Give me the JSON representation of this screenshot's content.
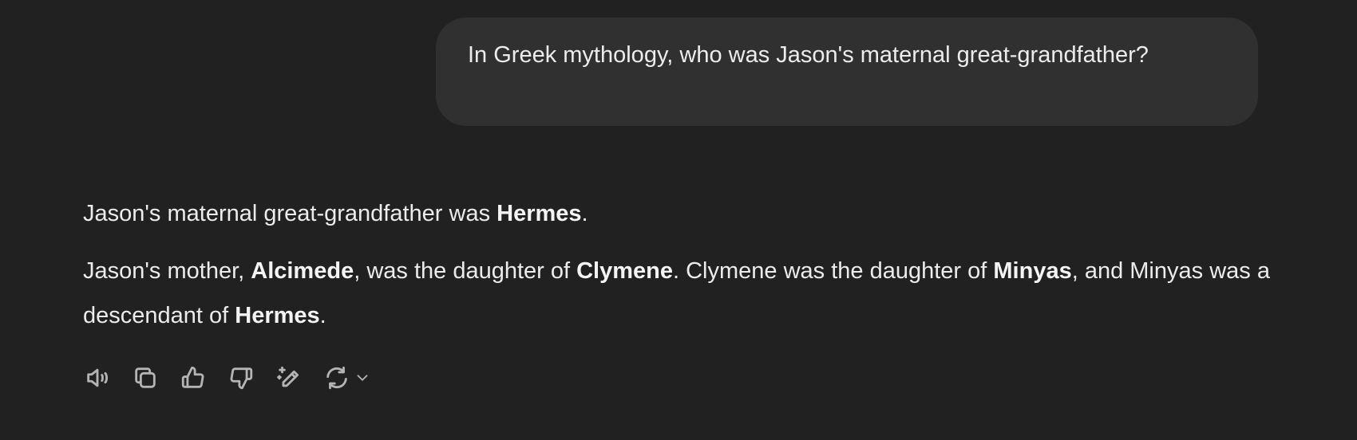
{
  "user_message": {
    "text": "In Greek mythology, who was Jason's maternal great-grandfather?"
  },
  "assistant_message": {
    "p1": {
      "t1": "Jason's maternal great-grandfather was ",
      "b1": "Hermes",
      "t2": "."
    },
    "p2": {
      "t1": "Jason's mother, ",
      "b1": "Alcimede",
      "t2": ", was the daughter of ",
      "b2": "Clymene",
      "t3": ". Clymene was the daughter of ",
      "b3": "Minyas",
      "t4": ", and Minyas was a descendant of ",
      "b4": "Hermes",
      "t5": "."
    }
  },
  "actions": [
    {
      "icon": "speaker-icon"
    },
    {
      "icon": "copy-icon"
    },
    {
      "icon": "thumbs-up-icon"
    },
    {
      "icon": "thumbs-down-icon"
    },
    {
      "icon": "edit-sparkle-icon"
    },
    {
      "icon": "regenerate-icon"
    },
    {
      "icon": "chevron-down-icon"
    }
  ],
  "colors": {
    "background": "#212121",
    "user_bubble": "#303030",
    "text": "#ececec",
    "icon": "#b4b4b4"
  }
}
